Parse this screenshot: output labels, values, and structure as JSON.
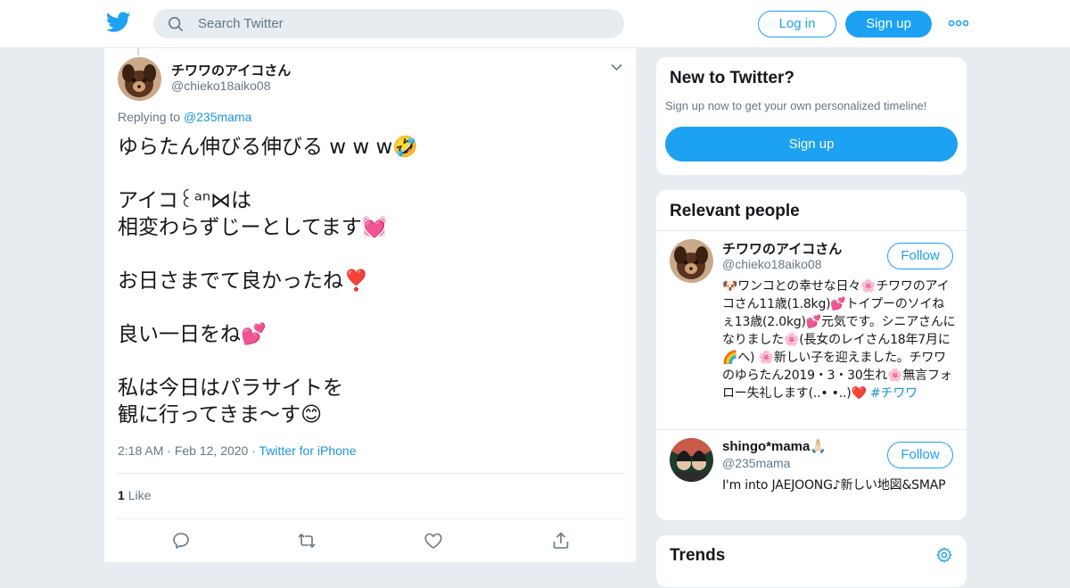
{
  "header": {
    "logo_icon": "twitter-bird-icon",
    "search_placeholder": "Search Twitter",
    "login_label": "Log in",
    "signup_label": "Sign up",
    "more_icon": "more-dots-icon"
  },
  "tweet": {
    "author_name": "チワワのアイコさん",
    "author_handle": "@chieko18aiko08",
    "replying_prefix": "Replying to ",
    "replying_to": "@235mama",
    "text": "ゆらたん伸びる伸びる w w w🤣\n\nアイコ꒰ᵃⁿ⋈は\n相変わらずじーとしてます💓\n\nお日さまでて良かったね❣️\n\n良い一日をね💕\n\n私は今日はパラサイトを\n観に行ってきま〜す😊",
    "time": "2:18 AM",
    "date": "Feb 12, 2020",
    "source": "Twitter for iPhone",
    "like_count": "1",
    "like_label": "Like",
    "actions": [
      "reply-icon",
      "retweet-icon",
      "like-icon",
      "share-icon"
    ]
  },
  "new_to_twitter": {
    "title": "New to Twitter?",
    "subtitle": "Sign up now to get your own personalized timeline!",
    "button": "Sign up"
  },
  "relevant_people": {
    "title": "Relevant people",
    "people": [
      {
        "name": "チワワのアイコさん",
        "handle": "@chieko18aiko08",
        "follow": "Follow",
        "bio": "🐶ワンコとの幸せな日々🌸チワワのアイコさん11歳(1.8kg)💕トイプーのソイねぇ13歳(2.0kg)💕元気です。シニアさんになりました🌸(長女のレイさん18年7月に🌈へ) 🌸新しい子を迎えました。チワワのゆらたん2019・3・30生れ🌸無言フォロー失礼します(..•  •..)❤️ ",
        "hashtag": "#チワワ"
      },
      {
        "name": "shingo*mama🙏🏻",
        "handle": "@235mama",
        "follow": "Follow",
        "bio": "I'm into JAEJOONG♪新しい地図&SMAP",
        "hashtag": ""
      }
    ]
  },
  "trends": {
    "title": "Trends",
    "settings_icon": "gear-icon"
  }
}
